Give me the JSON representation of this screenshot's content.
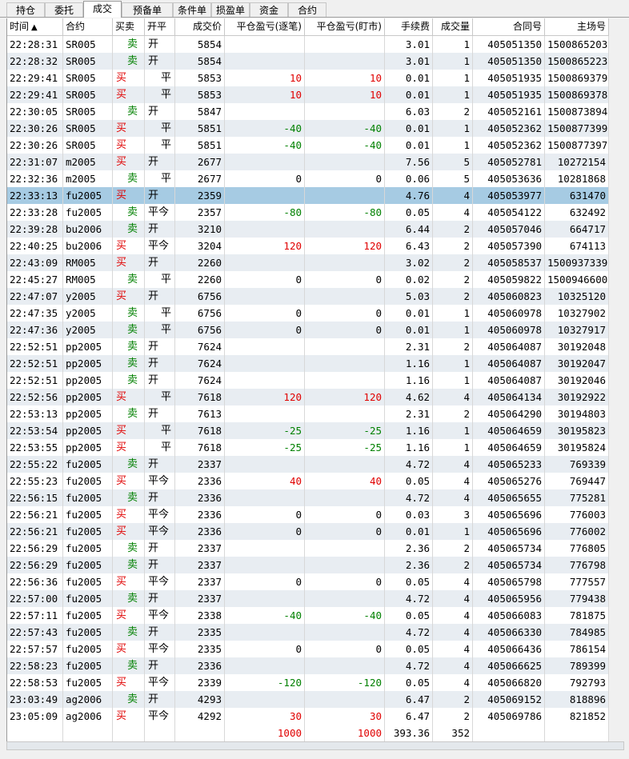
{
  "tabs": [
    {
      "label": "持仓",
      "active": false
    },
    {
      "label": "委托",
      "active": false
    },
    {
      "label": "成交",
      "active": true
    },
    {
      "label": "预备单",
      "active": false
    },
    {
      "label": "条件单",
      "active": false
    },
    {
      "label": "损盈单",
      "active": false
    },
    {
      "label": "资金",
      "active": false
    },
    {
      "label": "合约",
      "active": false
    }
  ],
  "columns": [
    "时间",
    "合约",
    "买卖",
    "开平",
    "成交价",
    "平仓盈亏(逐笔)",
    "平仓盈亏(盯市)",
    "手续费",
    "成交量",
    "合同号",
    "主场号"
  ],
  "sort_indicator": "▲",
  "colors": {
    "buy": "#e00000",
    "sell": "#008000",
    "selected_row": "#a6cbe3",
    "alt_row": "#e8edf2"
  },
  "rows": [
    [
      "22:28:31",
      "SR005",
      "卖",
      "开",
      "5854",
      "",
      "",
      "3.01",
      "1",
      "405051350",
      "1500865203"
    ],
    [
      "22:28:32",
      "SR005",
      "卖",
      "开",
      "5854",
      "",
      "",
      "3.01",
      "1",
      "405051350",
      "1500865223"
    ],
    [
      "22:29:41",
      "SR005",
      "买",
      "平",
      "5853",
      "10",
      "10",
      "0.01",
      "1",
      "405051935",
      "1500869379"
    ],
    [
      "22:29:41",
      "SR005",
      "买",
      "平",
      "5853",
      "10",
      "10",
      "0.01",
      "1",
      "405051935",
      "1500869378"
    ],
    [
      "22:30:05",
      "SR005",
      "卖",
      "开",
      "5847",
      "",
      "",
      "6.03",
      "2",
      "405052161",
      "1500873894"
    ],
    [
      "22:30:26",
      "SR005",
      "买",
      "平",
      "5851",
      "-40",
      "-40",
      "0.01",
      "1",
      "405052362",
      "1500877399"
    ],
    [
      "22:30:26",
      "SR005",
      "买",
      "平",
      "5851",
      "-40",
      "-40",
      "0.01",
      "1",
      "405052362",
      "1500877397"
    ],
    [
      "22:31:07",
      "m2005",
      "买",
      "开",
      "2677",
      "",
      "",
      "7.56",
      "5",
      "405052781",
      "10272154"
    ],
    [
      "22:32:36",
      "m2005",
      "卖",
      "平",
      "2677",
      "0",
      "0",
      "0.06",
      "5",
      "405053636",
      "10281868"
    ],
    [
      "22:33:13",
      "fu2005",
      "买",
      "开",
      "2359",
      "",
      "",
      "4.76",
      "4",
      "405053977",
      "631470"
    ],
    [
      "22:33:28",
      "fu2005",
      "卖",
      "平今",
      "2357",
      "-80",
      "-80",
      "0.05",
      "4",
      "405054122",
      "632492"
    ],
    [
      "22:39:28",
      "bu2006",
      "卖",
      "开",
      "3210",
      "",
      "",
      "6.44",
      "2",
      "405057046",
      "664717"
    ],
    [
      "22:40:25",
      "bu2006",
      "买",
      "平今",
      "3204",
      "120",
      "120",
      "6.43",
      "2",
      "405057390",
      "674113"
    ],
    [
      "22:43:09",
      "RM005",
      "买",
      "开",
      "2260",
      "",
      "",
      "3.02",
      "2",
      "405058537",
      "1500937339"
    ],
    [
      "22:45:27",
      "RM005",
      "卖",
      "平",
      "2260",
      "0",
      "0",
      "0.02",
      "2",
      "405059822",
      "1500946600"
    ],
    [
      "22:47:07",
      "y2005",
      "买",
      "开",
      "6756",
      "",
      "",
      "5.03",
      "2",
      "405060823",
      "10325120"
    ],
    [
      "22:47:35",
      "y2005",
      "卖",
      "平",
      "6756",
      "0",
      "0",
      "0.01",
      "1",
      "405060978",
      "10327902"
    ],
    [
      "22:47:36",
      "y2005",
      "卖",
      "平",
      "6756",
      "0",
      "0",
      "0.01",
      "1",
      "405060978",
      "10327917"
    ],
    [
      "22:52:51",
      "pp2005",
      "卖",
      "开",
      "7624",
      "",
      "",
      "2.31",
      "2",
      "405064087",
      "30192048"
    ],
    [
      "22:52:51",
      "pp2005",
      "卖",
      "开",
      "7624",
      "",
      "",
      "1.16",
      "1",
      "405064087",
      "30192047"
    ],
    [
      "22:52:51",
      "pp2005",
      "卖",
      "开",
      "7624",
      "",
      "",
      "1.16",
      "1",
      "405064087",
      "30192046"
    ],
    [
      "22:52:56",
      "pp2005",
      "买",
      "平",
      "7618",
      "120",
      "120",
      "4.62",
      "4",
      "405064134",
      "30192922"
    ],
    [
      "22:53:13",
      "pp2005",
      "卖",
      "开",
      "7613",
      "",
      "",
      "2.31",
      "2",
      "405064290",
      "30194803"
    ],
    [
      "22:53:54",
      "pp2005",
      "买",
      "平",
      "7618",
      "-25",
      "-25",
      "1.16",
      "1",
      "405064659",
      "30195823"
    ],
    [
      "22:53:55",
      "pp2005",
      "买",
      "平",
      "7618",
      "-25",
      "-25",
      "1.16",
      "1",
      "405064659",
      "30195824"
    ],
    [
      "22:55:22",
      "fu2005",
      "卖",
      "开",
      "2337",
      "",
      "",
      "4.72",
      "4",
      "405065233",
      "769339"
    ],
    [
      "22:55:23",
      "fu2005",
      "买",
      "平今",
      "2336",
      "40",
      "40",
      "0.05",
      "4",
      "405065276",
      "769447"
    ],
    [
      "22:56:15",
      "fu2005",
      "卖",
      "开",
      "2336",
      "",
      "",
      "4.72",
      "4",
      "405065655",
      "775281"
    ],
    [
      "22:56:21",
      "fu2005",
      "买",
      "平今",
      "2336",
      "0",
      "0",
      "0.03",
      "3",
      "405065696",
      "776003"
    ],
    [
      "22:56:21",
      "fu2005",
      "买",
      "平今",
      "2336",
      "0",
      "0",
      "0.01",
      "1",
      "405065696",
      "776002"
    ],
    [
      "22:56:29",
      "fu2005",
      "卖",
      "开",
      "2337",
      "",
      "",
      "2.36",
      "2",
      "405065734",
      "776805"
    ],
    [
      "22:56:29",
      "fu2005",
      "卖",
      "开",
      "2337",
      "",
      "",
      "2.36",
      "2",
      "405065734",
      "776798"
    ],
    [
      "22:56:36",
      "fu2005",
      "买",
      "平今",
      "2337",
      "0",
      "0",
      "0.05",
      "4",
      "405065798",
      "777557"
    ],
    [
      "22:57:00",
      "fu2005",
      "卖",
      "开",
      "2337",
      "",
      "",
      "4.72",
      "4",
      "405065956",
      "779438"
    ],
    [
      "22:57:11",
      "fu2005",
      "买",
      "平今",
      "2338",
      "-40",
      "-40",
      "0.05",
      "4",
      "405066083",
      "781875"
    ],
    [
      "22:57:43",
      "fu2005",
      "卖",
      "开",
      "2335",
      "",
      "",
      "4.72",
      "4",
      "405066330",
      "784985"
    ],
    [
      "22:57:57",
      "fu2005",
      "买",
      "平今",
      "2335",
      "0",
      "0",
      "0.05",
      "4",
      "405066436",
      "786154"
    ],
    [
      "22:58:23",
      "fu2005",
      "卖",
      "开",
      "2336",
      "",
      "",
      "4.72",
      "4",
      "405066625",
      "789399"
    ],
    [
      "22:58:53",
      "fu2005",
      "买",
      "平今",
      "2339",
      "-120",
      "-120",
      "0.05",
      "4",
      "405066820",
      "792793"
    ],
    [
      "23:03:49",
      "ag2006",
      "卖",
      "开",
      "4293",
      "",
      "",
      "6.47",
      "2",
      "405069152",
      "818896"
    ],
    [
      "23:05:09",
      "ag2006",
      "买",
      "平今",
      "4292",
      "30",
      "30",
      "6.47",
      "2",
      "405069786",
      "821852"
    ]
  ],
  "selected_row_index": 9,
  "totals": {
    "pnl_trade": "1000",
    "pnl_mark": "1000",
    "fee": "393.36",
    "volume": "352"
  }
}
